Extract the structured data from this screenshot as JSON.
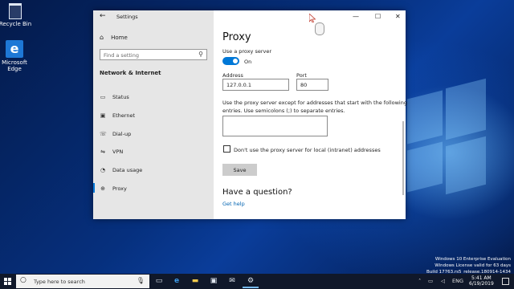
{
  "desktop": {
    "icons": [
      {
        "label": "Recycle Bin",
        "icon": "recycle-bin-icon"
      },
      {
        "label": "Microsoft Edge",
        "icon": "edge-icon"
      }
    ],
    "watermark": [
      "Windows 10 Enterprise Evaluation",
      "Windows License valid for 63 days",
      "Build 17763.rs5_release.180914-1434"
    ]
  },
  "window": {
    "title": "Settings",
    "controls": {
      "minimize": "—",
      "maximize": "☐",
      "close": "✕"
    }
  },
  "sidebar": {
    "home": "Home",
    "search_placeholder": "Find a setting",
    "section": "Network & Internet",
    "items": [
      {
        "label": "Status",
        "icon": "status-icon"
      },
      {
        "label": "Ethernet",
        "icon": "ethernet-icon"
      },
      {
        "label": "Dial-up",
        "icon": "dialup-icon"
      },
      {
        "label": "VPN",
        "icon": "vpn-icon"
      },
      {
        "label": "Data usage",
        "icon": "data-usage-icon"
      },
      {
        "label": "Proxy",
        "icon": "globe-icon",
        "active": true
      }
    ]
  },
  "proxy": {
    "title": "Proxy",
    "use_proxy_label": "Use a proxy server",
    "toggle_state": "On",
    "address_label": "Address",
    "address_value": "127.0.0.1",
    "port_label": "Port",
    "port_value": "80",
    "exceptions_line1": "Use the proxy server except for addresses that start with the following",
    "exceptions_line2": "entries. Use semicolons (;) to separate entries.",
    "exceptions_value": "",
    "local_checkbox_label": "Don't use the proxy server for local (intranet) addresses",
    "local_checked": false,
    "save_label": "Save",
    "question_heading": "Have a question?",
    "help_link": "Get help"
  },
  "taskbar": {
    "search_placeholder": "Type here to search",
    "tray_language": "ENG",
    "time": "5:41 AM",
    "date": "6/19/2019"
  },
  "colors": {
    "accent": "#0078d7",
    "link": "#0063b1",
    "taskbar": "#10182a"
  }
}
